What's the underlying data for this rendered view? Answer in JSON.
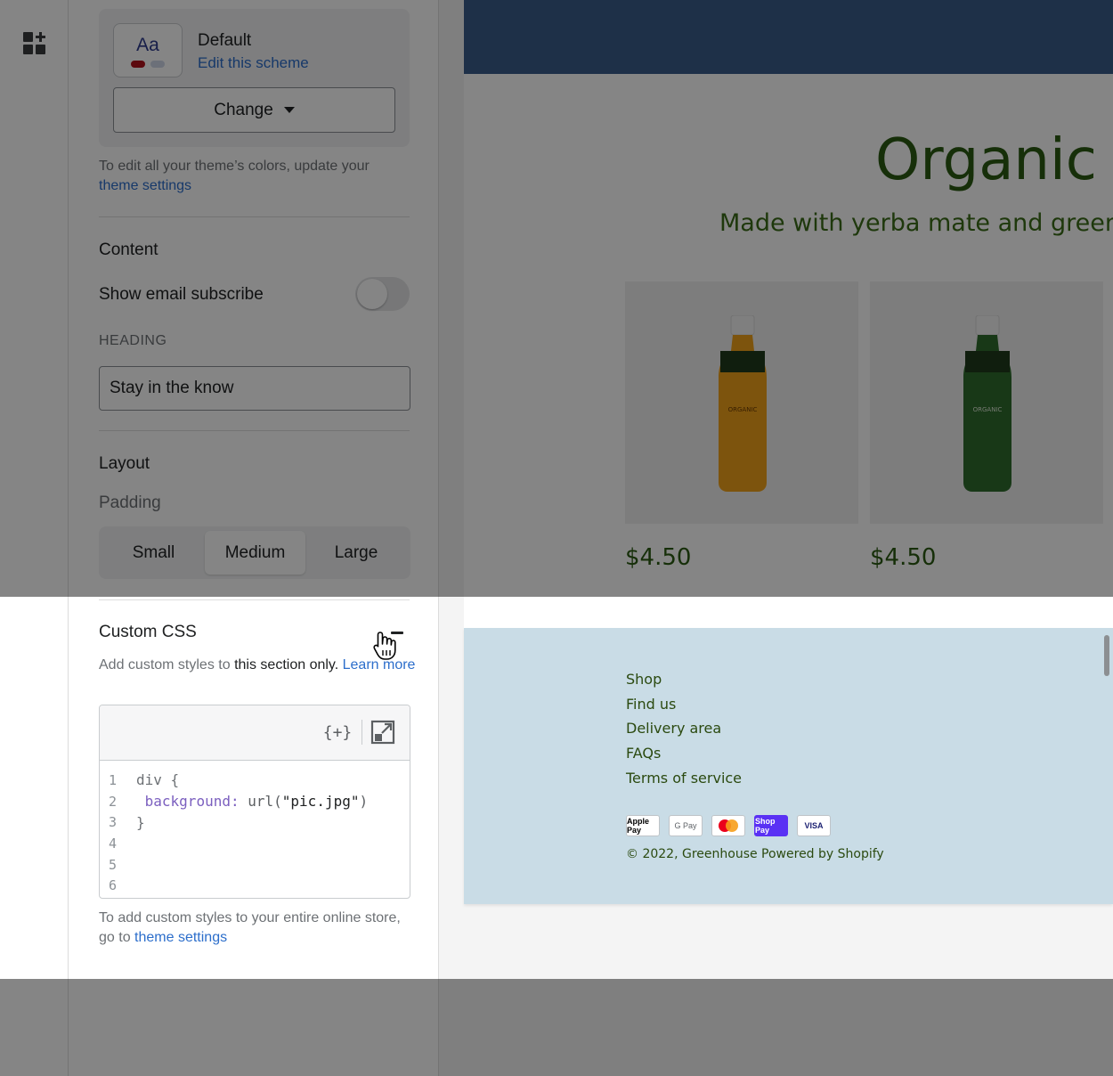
{
  "scheme": {
    "swatch_text": "Aa",
    "name": "Default",
    "edit_link": "Edit this scheme",
    "change_label": "Change",
    "hint_prefix": "To edit all your theme’s colors, update your",
    "hint_link": "theme settings"
  },
  "content": {
    "title": "Content",
    "email_toggle_label": "Show email subscribe",
    "email_toggle_on": false,
    "heading_label": "HEADING",
    "heading_value": "Stay in the know"
  },
  "layout": {
    "title": "Layout",
    "padding_label": "Padding",
    "padding_options": [
      "Small",
      "Medium",
      "Large"
    ],
    "padding_selected": "Medium"
  },
  "custom_css": {
    "title": "Custom CSS",
    "desc_prefix": "Add custom styles to",
    "desc_strong": "this section only.",
    "desc_link": "Learn more",
    "toolbar_insert": "{+}",
    "line_numbers": [
      "1",
      "2",
      "3",
      "4",
      "5",
      "6"
    ],
    "code": {
      "line1": "div {",
      "line2_prop": "background:",
      "line2_fn": "url(",
      "line2_str": "\"pic.jpg\"",
      "line2_close": ")",
      "line3": "}"
    },
    "footer_prefix": "To add custom styles to your entire online store, go to",
    "footer_link": "theme settings"
  },
  "preview": {
    "headline": "Organic",
    "subhead": "Made with yerba mate and green te",
    "products": [
      {
        "price": "$4.50",
        "bottle_color": "#f0a21a"
      },
      {
        "price": "$4.50",
        "bottle_color": "#2f6b2c"
      }
    ],
    "footer_links": [
      "Shop",
      "Find us",
      "Delivery area",
      "FAQs",
      "Terms of service"
    ],
    "payment_methods": [
      "Apple Pay",
      "G Pay",
      "Mastercard",
      "Shop Pay",
      "VISA"
    ],
    "copyright": "© 2022, Greenhouse Powered by Shopify"
  },
  "colors": {
    "accent_link": "#2c6ecb",
    "hero_band": "#3a5c8a",
    "headline_green": "#2b5a12",
    "footer_bg": "#c9dce6"
  }
}
